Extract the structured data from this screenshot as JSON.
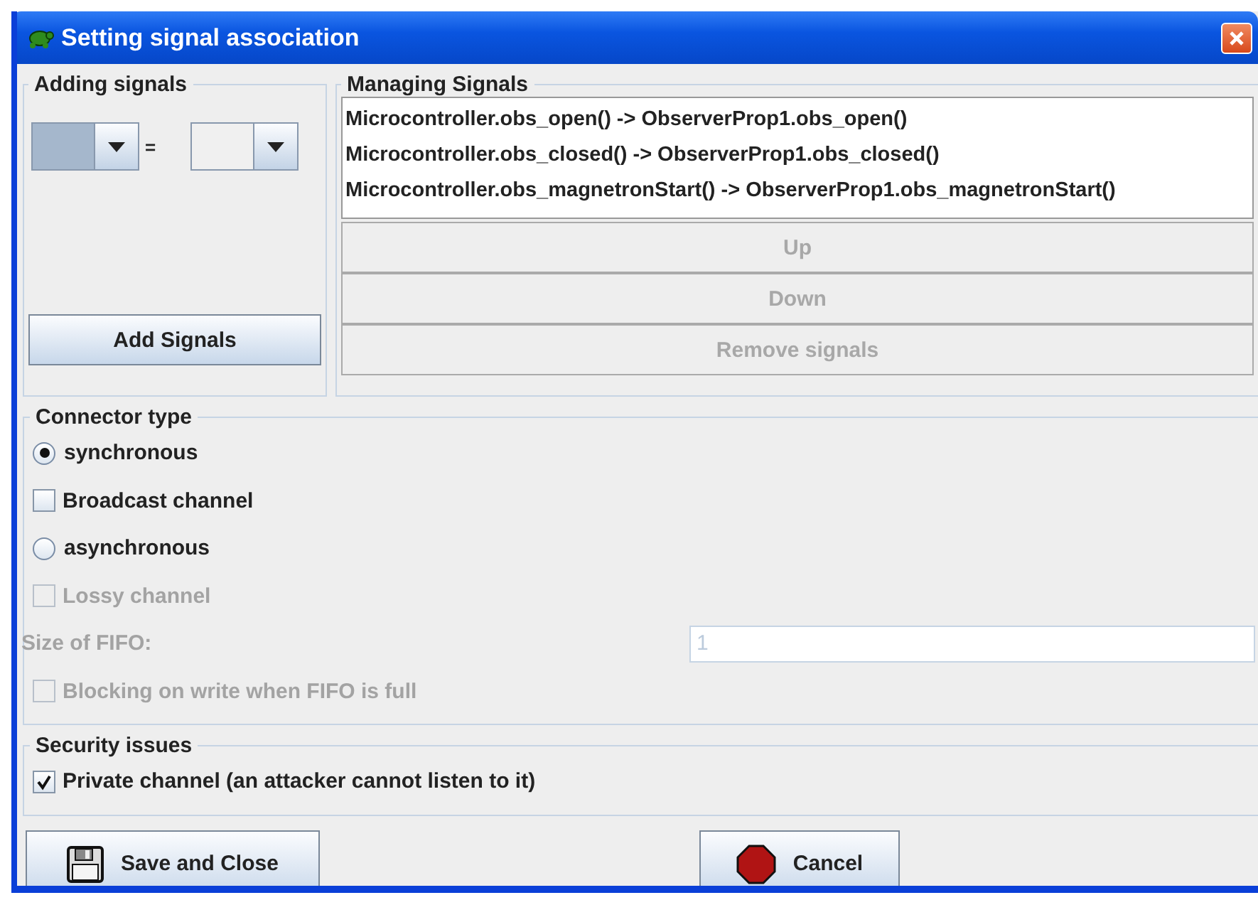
{
  "window": {
    "title": "Setting signal association"
  },
  "adding_signals": {
    "title": "Adding signals",
    "equals": "=",
    "add_button": "Add Signals"
  },
  "managing_signals": {
    "title": "Managing Signals",
    "signals": [
      "Microcontroller.obs_open() -> ObserverProp1.obs_open()",
      "Microcontroller.obs_closed() -> ObserverProp1.obs_closed()",
      "Microcontroller.obs_magnetronStart() -> ObserverProp1.obs_magnetronStart()"
    ],
    "buttons": [
      {
        "label": "Up",
        "disabled": true
      },
      {
        "label": "Down",
        "disabled": true
      },
      {
        "label": "Remove signals",
        "disabled": true
      }
    ]
  },
  "connector_type": {
    "title": "Connector type",
    "options": [
      {
        "kind": "radio",
        "label": "synchronous",
        "selected": true,
        "disabled": false
      },
      {
        "kind": "checkbox",
        "label": "Broadcast channel",
        "checked": false,
        "disabled": false
      },
      {
        "kind": "radio",
        "label": "asynchronous",
        "selected": false,
        "disabled": false
      },
      {
        "kind": "checkbox",
        "label": "Lossy channel",
        "checked": false,
        "disabled": true
      },
      {
        "kind": "field",
        "label": "Size of FIFO:",
        "value": "1",
        "disabled": true
      },
      {
        "kind": "checkbox",
        "label": "Blocking on write when FIFO is full",
        "checked": false,
        "disabled": true
      }
    ]
  },
  "security": {
    "title": "Security issues",
    "options": [
      {
        "kind": "checkbox",
        "label": "Private channel (an attacker cannot listen to it)",
        "checked": true,
        "disabled": false
      }
    ]
  },
  "buttons": [
    {
      "kind": "save",
      "label": "Save and Close"
    },
    {
      "kind": "cancel",
      "label": "Cancel"
    }
  ]
}
